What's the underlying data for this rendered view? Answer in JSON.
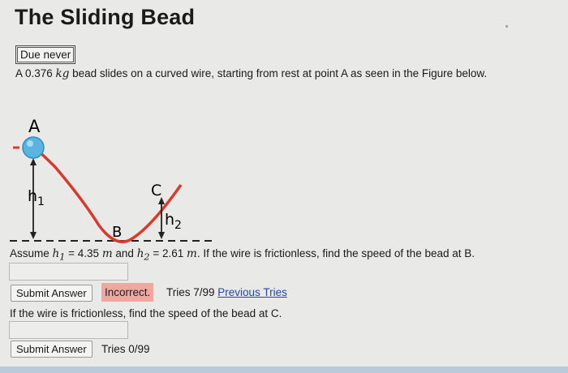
{
  "page": {
    "title": "The Sliding Bead",
    "due": "Due never",
    "intro": "A 0.376 kg bead slides on a curved wire, starting from rest at point A as seen in the Figure below."
  },
  "figure": {
    "labels": {
      "a": "A",
      "b": "B",
      "c": "C",
      "h1": "h",
      "h1_sub": "1",
      "h2": "h",
      "h2_sub": "2"
    },
    "colors": {
      "wire": "#d93a2b",
      "bead": "#5ab4df",
      "arrow": "#222222"
    }
  },
  "question1": {
    "text": "Assume h1 = 4.35 m and h2 = 2.61 m. If the wire is frictionless, find the speed of the bead at B.",
    "answer_value": "",
    "submit_label": "Submit Answer",
    "status": "Incorrect.",
    "tries": "Tries 7/99",
    "previous_tries_link": "Previous Tries"
  },
  "question2": {
    "text": "If the wire is frictionless, find the speed of the bead at C.",
    "answer_value": "",
    "submit_label": "Submit Answer",
    "tries": "Tries 0/99"
  }
}
